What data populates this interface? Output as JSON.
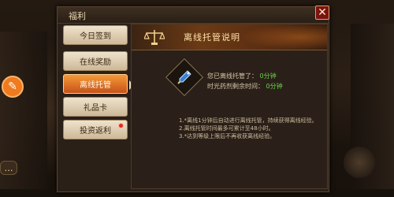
{
  "panel": {
    "title": "福利",
    "close_label": "✕"
  },
  "tabs": [
    {
      "label": "今日签到",
      "active": false,
      "badge": false
    },
    {
      "label": "在线奖励",
      "active": false,
      "badge": false
    },
    {
      "label": "离线托管",
      "active": true,
      "badge": false
    },
    {
      "label": "礼品卡",
      "active": false,
      "badge": false
    },
    {
      "label": "投资返利",
      "active": false,
      "badge": true
    }
  ],
  "content": {
    "banner_title": "离线托管说明",
    "banner_icon": "scale-icon",
    "item_icon": "potion-icon",
    "lines": [
      {
        "label": "您已离线托管了：",
        "value": "0分钟"
      },
      {
        "label": "时光药剂剩余时间：",
        "value": "0分钟"
      }
    ],
    "notes": [
      "1.*离线1分钟后自动进行离线托管，持续获得离线经验。",
      "2.离线托管时间最多可累计至48小时。",
      "3.*达到等级上限后不再收获离线经验。"
    ]
  },
  "colors": {
    "active_tab": "#e07a2a",
    "value_green": "#6bd24a",
    "close_red": "#7a1410"
  }
}
